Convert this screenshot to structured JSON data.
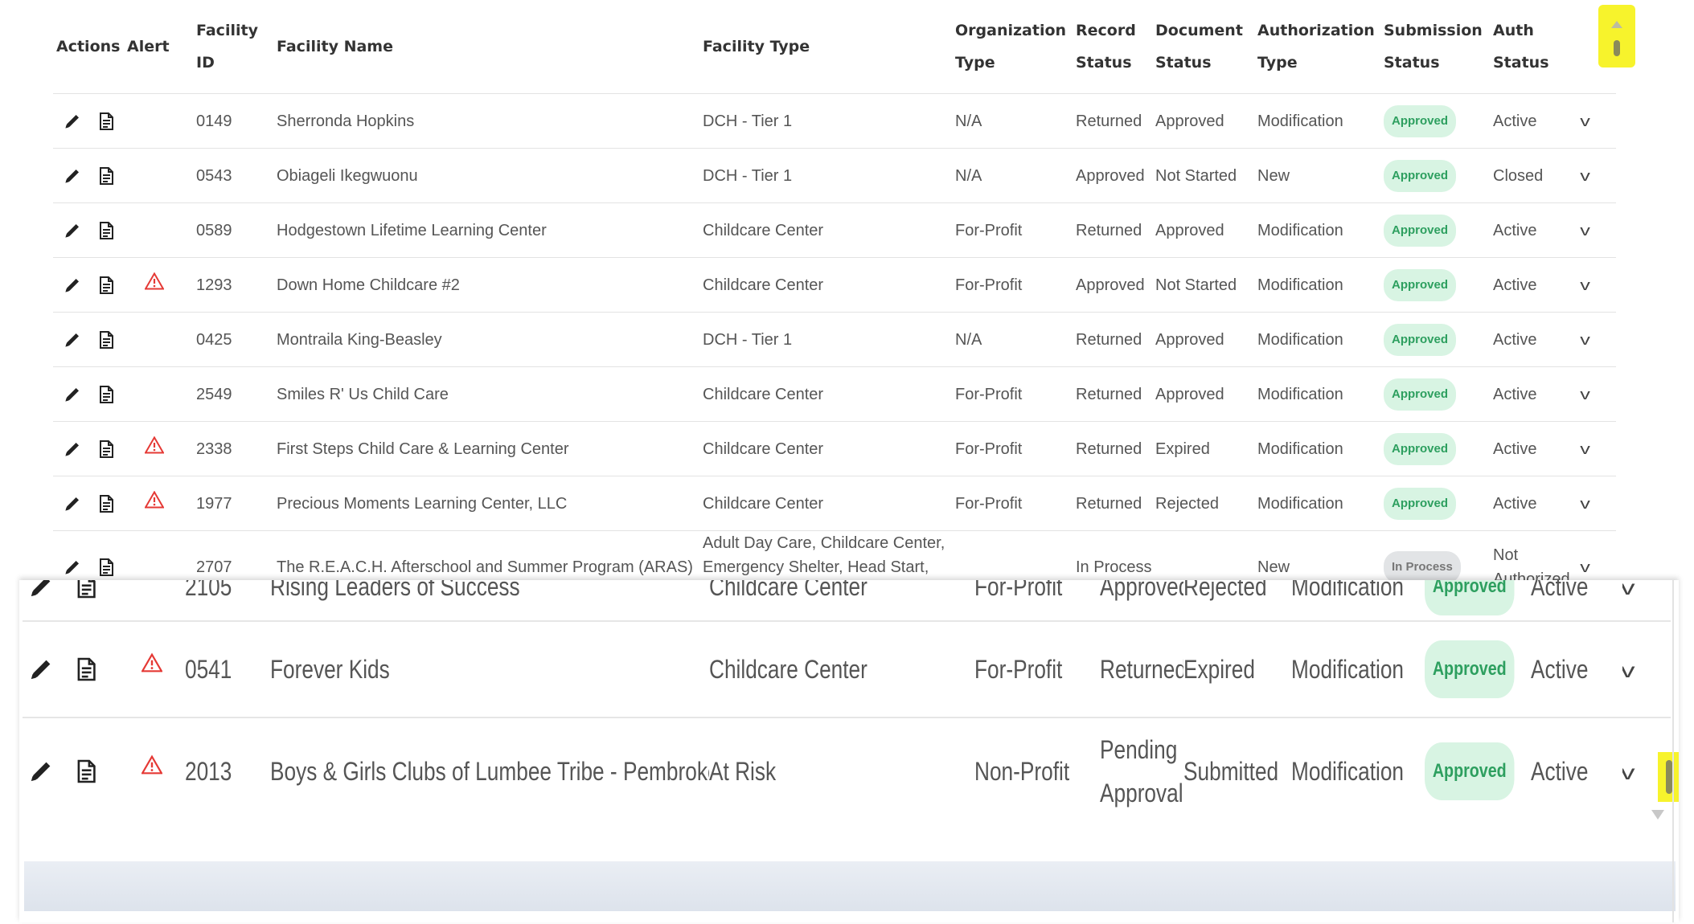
{
  "columns": [
    {
      "l1": "Actions",
      "l2": ""
    },
    {
      "l1": "Alert",
      "l2": ""
    },
    {
      "l1": "Facility",
      "l2": "ID"
    },
    {
      "l1": "Facility Name",
      "l2": ""
    },
    {
      "l1": "Facility Type",
      "l2": ""
    },
    {
      "l1": "Organization",
      "l2": "Type"
    },
    {
      "l1": "Record",
      "l2": "Status"
    },
    {
      "l1": "Document",
      "l2": "Status"
    },
    {
      "l1": "Authorization",
      "l2": "Type"
    },
    {
      "l1": "Submission",
      "l2": "Status"
    },
    {
      "l1": "Auth",
      "l2": "Status"
    }
  ],
  "rows": [
    {
      "alert": false,
      "id": "0149",
      "name": "Sherronda Hopkins",
      "ftype": "DCH - Tier 1",
      "org": "N/A",
      "record": "Returned",
      "doc": "Approved",
      "auth_type": "Modification",
      "submission": "Approved",
      "auth_status": "Active"
    },
    {
      "alert": false,
      "id": "0543",
      "name": "Obiageli Ikegwuonu",
      "ftype": "DCH - Tier 1",
      "org": "N/A",
      "record": "Approved",
      "doc": "Not Started",
      "auth_type": "New",
      "submission": "Approved",
      "auth_status": "Closed"
    },
    {
      "alert": false,
      "id": "0589",
      "name": "Hodgestown Lifetime Learning Center",
      "ftype": "Childcare Center",
      "org": "For-Profit",
      "record": "Returned",
      "doc": "Approved",
      "auth_type": "Modification",
      "submission": "Approved",
      "auth_status": "Active"
    },
    {
      "alert": true,
      "id": "1293",
      "name": "Down Home Childcare #2",
      "ftype": "Childcare Center",
      "org": "For-Profit",
      "record": "Approved",
      "doc": "Not Started",
      "auth_type": "Modification",
      "submission": "Approved",
      "auth_status": "Active"
    },
    {
      "alert": false,
      "id": "0425",
      "name": "Montraila King-Beasley",
      "ftype": "DCH - Tier 1",
      "org": "N/A",
      "record": "Returned",
      "doc": "Approved",
      "auth_type": "Modification",
      "submission": "Approved",
      "auth_status": "Active"
    },
    {
      "alert": false,
      "id": "2549",
      "name": "Smiles R' Us Child Care",
      "ftype": "Childcare Center",
      "org": "For-Profit",
      "record": "Returned",
      "doc": "Approved",
      "auth_type": "Modification",
      "submission": "Approved",
      "auth_status": "Active"
    },
    {
      "alert": true,
      "id": "2338",
      "name": "First Steps Child Care & Learning Center",
      "ftype": "Childcare Center",
      "org": "For-Profit",
      "record": "Returned",
      "doc": "Expired",
      "auth_type": "Modification",
      "submission": "Approved",
      "auth_status": "Active"
    },
    {
      "alert": true,
      "id": "1977",
      "name": "Precious Moments Learning Center, LLC",
      "ftype": "Childcare Center",
      "org": "For-Profit",
      "record": "Returned",
      "doc": "Rejected",
      "auth_type": "Modification",
      "submission": "Approved",
      "auth_status": "Active"
    },
    {
      "alert": false,
      "id": "2707",
      "name": "The R.E.A.C.H. Afterschool and Summer Program (ARAS)",
      "ftype": "Adult Day Care, Childcare Center, Emergency Shelter, Head Start, OSHC",
      "org": "",
      "record": "In Process",
      "doc": "",
      "auth_type": "New",
      "submission": "In Process",
      "submission_style": "grey",
      "auth_status": "Not Authorized"
    }
  ],
  "zoom_rows": [
    {
      "alert": false,
      "id": "2105",
      "name": "Rising Leaders of Success",
      "ftype": "Childcare Center",
      "org": "For-Profit",
      "record": "Approved",
      "doc": "Rejected",
      "auth_type": "Modification",
      "submission": "Approved",
      "auth_status": "Active"
    },
    {
      "alert": true,
      "id": "0541",
      "name": "Forever Kids",
      "ftype": "Childcare Center",
      "org": "For-Profit",
      "record": "Returned",
      "doc": "Expired",
      "auth_type": "Modification",
      "submission": "Approved",
      "auth_status": "Active"
    },
    {
      "alert": true,
      "id": "2013",
      "name": "Boys & Girls Clubs of Lumbee Tribe - Pembroke (ARAS)",
      "ftype": "At Risk",
      "org": "Non-Profit",
      "record": "Pending Approval",
      "doc": "Submitted",
      "auth_type": "Modification",
      "submission": "Approved",
      "auth_status": "Active"
    }
  ],
  "icons": {
    "edit": "pencil-icon",
    "document": "document-icon",
    "alert": "warning-triangle-icon",
    "expand": "chevron-down-icon"
  },
  "chevron_glyph": "v",
  "colors": {
    "approved_bg": "#d8f4e3",
    "approved_text": "#2d9f5f",
    "in_process_bg": "#e2e4e6",
    "alert_red": "#e53935",
    "highlight": "#f7f32c"
  }
}
